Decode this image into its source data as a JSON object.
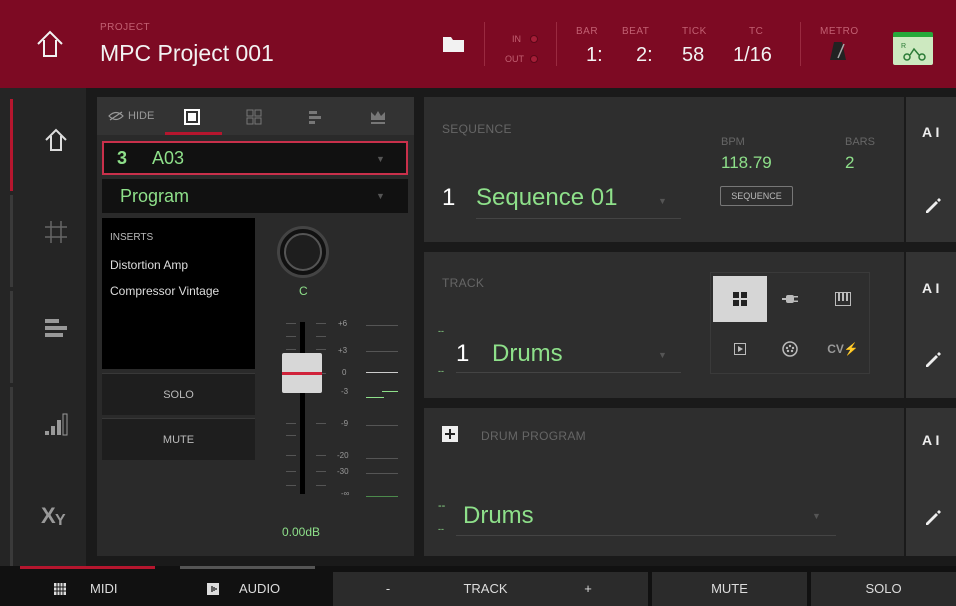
{
  "header": {
    "project_label": "PROJECT",
    "project_name": "MPC Project 001",
    "in_label": "IN",
    "out_label": "OUT",
    "bar_label": "BAR",
    "beat_label": "BEAT",
    "tick_label": "TICK",
    "tc_label": "TC",
    "metro_label": "METRO",
    "bar_value": "1:",
    "beat_value": "2:",
    "tick_value": "58",
    "tc_value": "1/16",
    "colors": {
      "background": "#7d0a23",
      "accent": "#b5162e",
      "green": "#8ee08a"
    }
  },
  "nav": {
    "items": [
      {
        "icon": "home-icon"
      },
      {
        "icon": "grid-icon"
      },
      {
        "icon": "track-list-icon"
      },
      {
        "icon": "level-bars-icon"
      },
      {
        "icon": "xy-icon"
      }
    ]
  },
  "strip": {
    "hide_label": "HIDE",
    "track_number": "3",
    "track_name": "A03",
    "program_type": "Program",
    "inserts_title": "INSERTS",
    "inserts": [
      "Distortion Amp",
      "Compressor Vintage"
    ],
    "pan": "C",
    "solo_label": "SOLO",
    "mute_label": "MUTE",
    "fader_scale": [
      "+6",
      "+3",
      "0",
      "-3",
      "-9",
      "-20",
      "-30",
      "-∞"
    ],
    "volume": "0.00dB"
  },
  "sequence": {
    "label": "SEQUENCE",
    "number": "1",
    "name": "Sequence 01",
    "bpm_label": "BPM",
    "bpm": "118.79",
    "bars_label": "BARS",
    "bars": "2",
    "button": "SEQUENCE"
  },
  "track": {
    "label": "TRACK",
    "dash": "--",
    "number": "1",
    "name": "Drums",
    "types": [
      "drum-pads-icon",
      "plugin-icon",
      "keygroup-icon",
      "clip-icon",
      "midi-icon",
      "CV⚡"
    ]
  },
  "program": {
    "label": "DRUM PROGRAM",
    "dash": "--",
    "name": "Drums"
  },
  "bottom": {
    "midi": "MIDI",
    "audio": "AUDIO",
    "minus": "-",
    "track": "TRACK",
    "plus": "+",
    "mute": "MUTE",
    "solo": "SOLO"
  },
  "side": {
    "text_icon": "A I"
  }
}
